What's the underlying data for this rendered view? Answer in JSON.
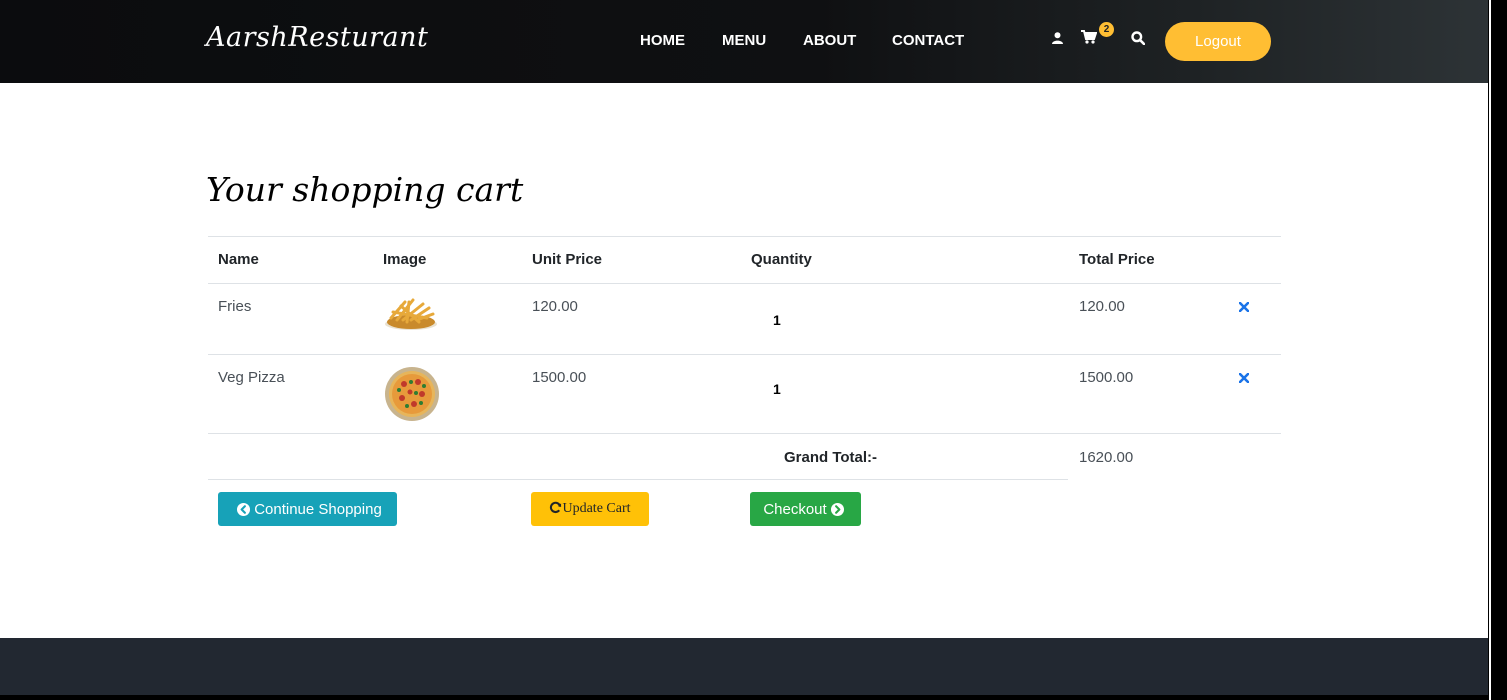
{
  "header": {
    "brand": "AarshResturant",
    "nav": [
      "HOME",
      "MENU",
      "ABOUT",
      "CONTACT"
    ],
    "cart_count": "2",
    "logout_label": "Logout",
    "icons": {
      "user": "user-icon",
      "cart": "cart-icon",
      "search": "search-icon"
    }
  },
  "cart": {
    "title": "Your shopping cart",
    "columns": [
      "Name",
      "Image",
      "Unit Price",
      "Quantity",
      "Total Price"
    ],
    "items": [
      {
        "name": "Fries",
        "unit_price": "120.00",
        "quantity": "1",
        "total_price": "120.00"
      },
      {
        "name": "Veg Pizza",
        "unit_price": "1500.00",
        "quantity": "1",
        "total_price": "1500.00"
      }
    ],
    "grand_total_label": "Grand Total:-",
    "grand_total": "1620.00"
  },
  "actions": {
    "continue_label": "Continue Shopping",
    "update_label": "Update Cart",
    "checkout_label": "Checkout"
  },
  "colors": {
    "accent": "#ffbe33",
    "continue": "#17a2b8",
    "update": "#ffc107",
    "checkout": "#28a745",
    "footer": "#222831"
  }
}
